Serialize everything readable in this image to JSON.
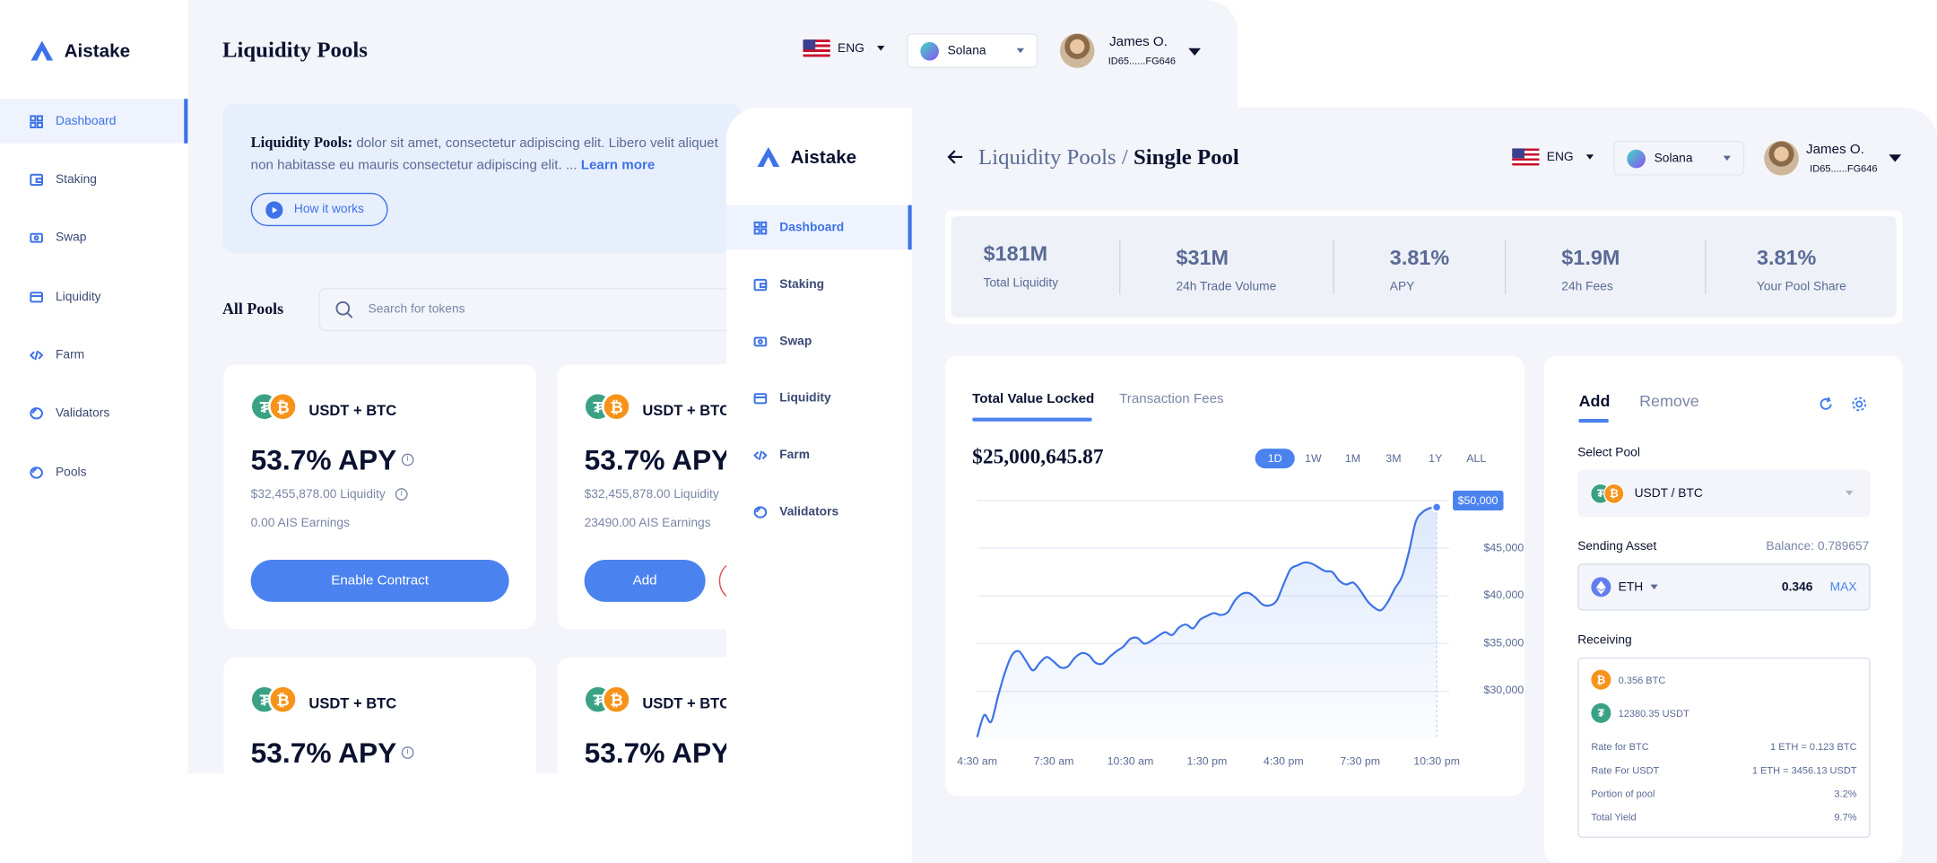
{
  "brand": {
    "name": "Aistake"
  },
  "nav": {
    "items": [
      {
        "label": "Dashboard",
        "icon": "grid-icon"
      },
      {
        "label": "Staking",
        "icon": "wallet-icon"
      },
      {
        "label": "Swap",
        "icon": "swap-icon"
      },
      {
        "label": "Liquidity",
        "icon": "card-icon"
      },
      {
        "label": "Farm",
        "icon": "code-icon"
      },
      {
        "label": "Validators",
        "icon": "ring-icon"
      },
      {
        "label": "Pools",
        "icon": "ring-icon"
      }
    ]
  },
  "header": {
    "language": "ENG",
    "network": "Solana",
    "user_name": "James O.",
    "user_id": "ID65......FG646"
  },
  "back": {
    "title": "Liquidity Pools",
    "info_bold": "Liquidity Pools:",
    "info_line1": " dolor sit amet, consectetur adipiscing elit. Libero velit aliquet",
    "info_line2": "non habitasse eu mauris consectetur adipiscing elit. ... ",
    "learn_more": "Learn more",
    "how_it_works": "How it works",
    "all_pools": "All Pools",
    "search_placeholder": "Search for tokens",
    "cards": [
      {
        "pair": "USDT + BTC",
        "apy": "53.7% APY",
        "liquidity": "$32,455,878.00 Liquidity",
        "earnings": "0.00 AIS Earnings",
        "button": "Enable Contract"
      },
      {
        "pair": "USDT + BTC",
        "apy": "53.7% APY",
        "liquidity": "$32,455,878.00 Liquidity",
        "earnings": "23490.00 AIS Earnings",
        "button": "Add"
      },
      {
        "pair": "USDT + BTC",
        "apy": "53.7% APY"
      },
      {
        "pair": "USDT + BTC",
        "apy": "53.7% APY"
      }
    ]
  },
  "front": {
    "breadcrumb_parent": "Liquidity Pools /",
    "breadcrumb_current": "Single Pool",
    "stats": [
      {
        "value": "$181M",
        "label": "Total Liquidity"
      },
      {
        "value": "$31M",
        "label": "24h Trade Volume"
      },
      {
        "value": "3.81%",
        "label": "APY"
      },
      {
        "value": "$1.9M",
        "label": "24h Fees"
      },
      {
        "value": "3.81%",
        "label": "Your Pool Share"
      }
    ],
    "tabs": [
      "Total Value Locked",
      "Transaction Fees"
    ],
    "tvl_value": "$25,000,645.87",
    "ranges": [
      "1D",
      "1W",
      "1M",
      "3M",
      "1Y",
      "ALL"
    ],
    "active_range": "1D",
    "panel": {
      "tab_add": "Add",
      "tab_remove": "Remove",
      "select_pool_label": "Select Pool",
      "pool": "USDT / BTC",
      "sending_label": "Sending Asset",
      "balance": "Balance: 0.789657",
      "asset": "ETH",
      "amount": "0.346",
      "max": "MAX",
      "receiving_label": "Receiving",
      "receive_btc": "0.356 BTC",
      "receive_usdt": "12380.35 USDT",
      "rows": [
        {
          "k": "Rate for BTC",
          "v": "1 ETH = 0.123 BTC"
        },
        {
          "k": "Rate For USDT",
          "v": "1 ETH = 3456.13 USDT"
        },
        {
          "k": "Portion of pool",
          "v": "3.2%"
        },
        {
          "k": "Total Yield",
          "v": "9.7%"
        }
      ]
    }
  },
  "chart_data": {
    "type": "area",
    "title": "",
    "x_labels": [
      "4:30 am",
      "7:30 am",
      "10:30 am",
      "1:30 pm",
      "4:30 pm",
      "7:30 pm",
      "10:30 pm"
    ],
    "y_ticks": [
      "$30,000",
      "$35,000",
      "$40,000",
      "$45,000",
      "$50,000"
    ],
    "ylim": [
      25000,
      50000
    ],
    "last_value_label": "$50,000",
    "values": [
      25200,
      27500,
      26800,
      29500,
      32000,
      33800,
      34200,
      33200,
      32200,
      33000,
      33600,
      33100,
      32500,
      32600,
      33500,
      34000,
      33800,
      33000,
      32900,
      33600,
      34200,
      34700,
      35500,
      35600,
      35000,
      35300,
      35800,
      36200,
      35900,
      36700,
      37000,
      36600,
      37500,
      37900,
      38200,
      38000,
      38300,
      39500,
      40200,
      40300,
      39800,
      39100,
      39000,
      39500,
      41200,
      42800,
      43200,
      43500,
      43400,
      43000,
      42600,
      42500,
      41600,
      41200,
      41400,
      40600,
      39500,
      38800,
      38500,
      39400,
      40800,
      42000,
      44600,
      47800,
      48800,
      49200,
      49300
    ]
  },
  "colors": {
    "accent": "#4a82f0",
    "bg": "#f3f5fa",
    "text": "#0b1230",
    "muted": "#5a6a96"
  }
}
